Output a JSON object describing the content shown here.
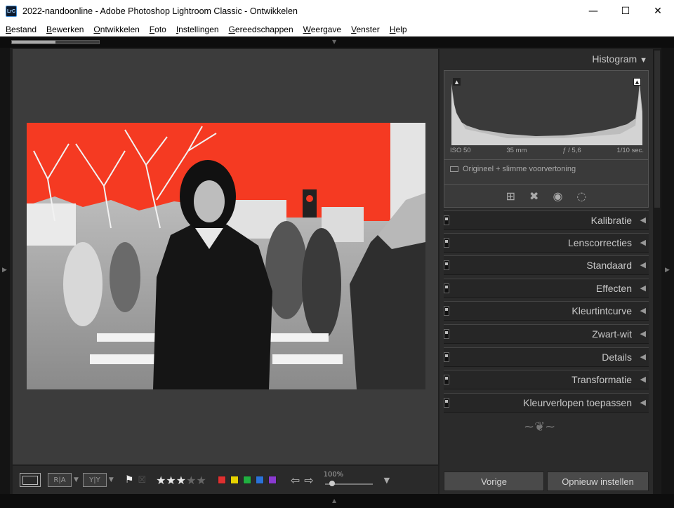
{
  "window": {
    "title": "2022-nandoonline - Adobe Photoshop Lightroom Classic - Ontwikkelen",
    "app_badge": "LrC"
  },
  "menu": [
    {
      "u": "B",
      "rest": "estand"
    },
    {
      "u": "B",
      "rest": "ewerken",
      "pre": ""
    },
    {
      "u": "O",
      "rest": "ntwikkelen"
    },
    {
      "u": "F",
      "rest": "oto"
    },
    {
      "u": "I",
      "rest": "nstellingen"
    },
    {
      "u": "G",
      "rest": "ereedschappen"
    },
    {
      "u": "W",
      "rest": "eergave"
    },
    {
      "u": "V",
      "rest": "enster"
    },
    {
      "u": "H",
      "rest": "elp"
    }
  ],
  "histogram": {
    "title": "Histogram",
    "iso": "ISO 50",
    "focal": "35 mm",
    "aperture": "ƒ / 5,6",
    "shutter": "1/10 sec.",
    "preview_label": "Origineel + slimme voorvertoning"
  },
  "sections": [
    "Kalibratie",
    "Lenscorrecties",
    "Standaard",
    "Effecten",
    "Kleurtintcurve",
    "Zwart-wit",
    "Details",
    "Transformatie",
    "Kleurverlopen toepassen"
  ],
  "toolbar": {
    "ra": "R|A",
    "yy": "Y|Y",
    "rating": 3,
    "max_rating": 5,
    "zoom": "100%",
    "colors": [
      "#e03030",
      "#e6d200",
      "#20b040",
      "#2a72d8",
      "#8a3ad0"
    ]
  },
  "buttons": {
    "prev": "Vorige",
    "reset": "Opnieuw instellen"
  }
}
